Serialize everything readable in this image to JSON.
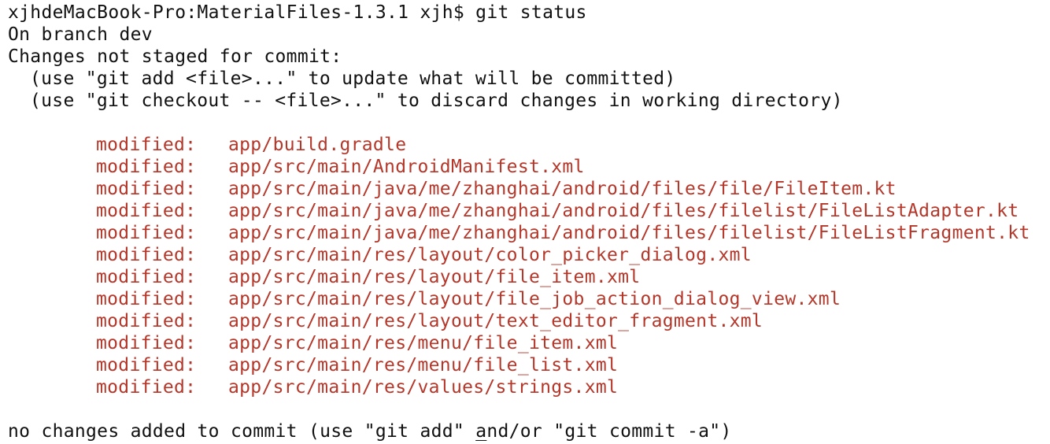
{
  "terminal": {
    "prompt_line": "xjhdeMacBook-Pro:MaterialFiles-1.3.1 xjh$ git status",
    "branch_line": "On branch dev",
    "changes_header": "Changes not staged for commit:",
    "hint_add": "(use \"git add <file>...\" to update what will be committed)",
    "hint_checkout": "(use \"git checkout -- <file>...\" to discard changes in working directory)",
    "modified_files": [
      {
        "status": "modified:",
        "path": "app/build.gradle"
      },
      {
        "status": "modified:",
        "path": "app/src/main/AndroidManifest.xml"
      },
      {
        "status": "modified:",
        "path": "app/src/main/java/me/zhanghai/android/files/file/FileItem.kt"
      },
      {
        "status": "modified:",
        "path": "app/src/main/java/me/zhanghai/android/files/filelist/FileListAdapter.kt"
      },
      {
        "status": "modified:",
        "path": "app/src/main/java/me/zhanghai/android/files/filelist/FileListFragment.kt"
      },
      {
        "status": "modified:",
        "path": "app/src/main/res/layout/color_picker_dialog.xml"
      },
      {
        "status": "modified:",
        "path": "app/src/main/res/layout/file_item.xml"
      },
      {
        "status": "modified:",
        "path": "app/src/main/res/layout/file_job_action_dialog_view.xml"
      },
      {
        "status": "modified:",
        "path": "app/src/main/res/layout/text_editor_fragment.xml"
      },
      {
        "status": "modified:",
        "path": "app/src/main/res/menu/file_item.xml"
      },
      {
        "status": "modified:",
        "path": "app/src/main/res/menu/file_list.xml"
      },
      {
        "status": "modified:",
        "path": "app/src/main/res/values/strings.xml"
      }
    ],
    "footer_before": "no changes added to commit (use \"git add\" ",
    "footer_cursor": "a",
    "footer_after": "nd/or \"git commit -a\")"
  },
  "colors": {
    "modified_text": "#b5372a",
    "normal_text": "#111111",
    "background": "#ffffff"
  }
}
